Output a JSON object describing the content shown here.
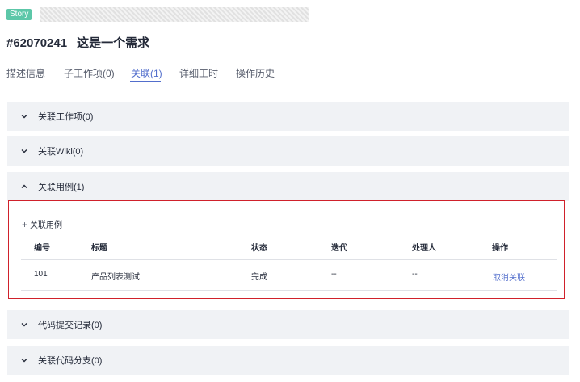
{
  "header": {
    "badge": "Story",
    "issue_id": "#62070241",
    "title": "这是一个需求"
  },
  "tabs": [
    {
      "label": "描述信息",
      "active": false
    },
    {
      "label": "子工作项(0)",
      "active": false
    },
    {
      "label": "关联(1)",
      "active": true
    },
    {
      "label": "详细工时",
      "active": false
    },
    {
      "label": "操作历史",
      "active": false
    }
  ],
  "panels": {
    "work_items": {
      "label": "关联工作项(0)",
      "expanded": false
    },
    "wiki": {
      "label": "关联Wiki(0)",
      "expanded": false
    },
    "test_cases": {
      "label": "关联用例(1)",
      "expanded": true
    },
    "commits": {
      "label": "代码提交记录(0)",
      "expanded": false
    },
    "branches": {
      "label": "关联代码分支(0)",
      "expanded": false
    }
  },
  "test_case_table": {
    "add_label": "关联用例",
    "columns": [
      "编号",
      "标题",
      "状态",
      "迭代",
      "处理人",
      "操作"
    ],
    "rows": [
      {
        "id": "101",
        "title": "产品列表测试",
        "status": "完成",
        "iteration": "--",
        "assignee": "--",
        "action": "取消关联"
      }
    ]
  },
  "colors": {
    "accent": "#526ecc",
    "badge": "#5cc7a8",
    "highlight_border": "#d0212b",
    "panel_bg": "#f0f2f5"
  }
}
